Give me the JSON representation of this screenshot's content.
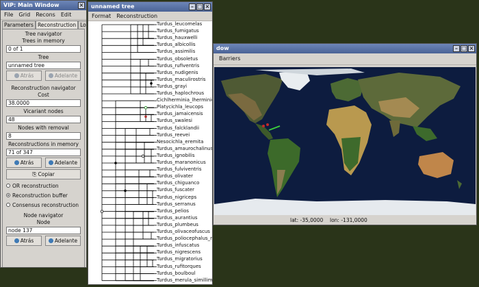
{
  "main": {
    "title": "VIP: Main Window",
    "menu": [
      "File",
      "Grid",
      "Recons",
      "Edit"
    ],
    "tabs": [
      "Parameters",
      "Reconstruction",
      "Log"
    ],
    "tree_navigator": {
      "heading": "Tree navigator",
      "trees_label": "Trees in memory",
      "trees_value": "0 of 1",
      "tree_label": "Tree",
      "tree_value": "unnamed tree",
      "back": "Atrás",
      "forward": "Adelante"
    },
    "recon_navigator": {
      "heading": "Reconstruction navigator",
      "cost_label": "Cost",
      "cost_value": "38.0000",
      "vicariant_label": "Vicariant nodes",
      "vicariant_value": "48",
      "removal_label": "Nodes with removal",
      "removal_value": "8",
      "memory_label": "Reconstructions in memory",
      "memory_value": "71 of 347",
      "back": "Atrás",
      "forward": "Adelante",
      "copy": "Copiar"
    },
    "radios": [
      "OR reconstruction",
      "Reconstruction buffer",
      "Consensus reconstruction"
    ],
    "node_navigator": {
      "heading": "Node navigator",
      "node_label": "Node",
      "node_value": "node 137",
      "back": "Atrás",
      "forward": "Adelante"
    }
  },
  "tree": {
    "title": "unnamed tree",
    "menu": [
      "Format",
      "Reconstruction"
    ],
    "taxa": [
      "Turdus_leucomelas",
      "Turdus_fumigatus",
      "Turdus_hauxwelli",
      "Turdus_albicollis",
      "Turdus_assimilis",
      "Turdus_obsoletus",
      "Turdus_rufiventris",
      "Turdus_nudigenis",
      "Turdus_maculirostris",
      "Turdus_grayi",
      "Turdus_haplochrous",
      "Cichlherminia_lherminie",
      "Platycichla_leucops",
      "Turdus_jamaicensis",
      "Turdus_swalesi",
      "Turdus_falcklandii",
      "Turdus_reevei",
      "Nesocichla_eremita",
      "Turdus_amaurochalinus",
      "Turdus_ignobilis",
      "Turdus_maranonicus",
      "Turdus_fulviventris",
      "Turdus_olivater",
      "Turdus_chiguanco",
      "Turdus_fuscater",
      "Turdus_nigriceps",
      "Turdus_serranus",
      "Turdus_pelios",
      "Turdus_aurantius",
      "Turdus_plumbeus",
      "Turdus_olivaceofuscus",
      "Turdus_poliocephalus_n",
      "Turdus_infuscatus",
      "Turdus_nigrescens",
      "Turdus_migratorius",
      "Turdus_rufitorques",
      "Turdus_boulboul",
      "Turdus_merula_simillim"
    ]
  },
  "map": {
    "title": "dow",
    "menu": [
      "Barriers"
    ],
    "lat": "lat: -35,0000",
    "lon": "lon: -131,0000"
  }
}
